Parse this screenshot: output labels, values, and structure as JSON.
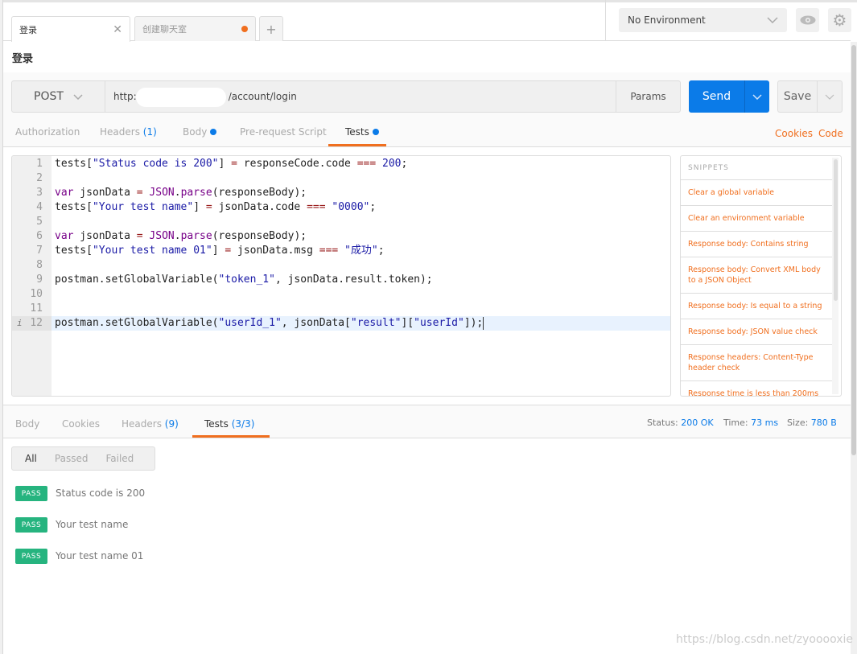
{
  "tabs": [
    {
      "label": "登录",
      "active": true
    },
    {
      "label": "创建聊天室",
      "unsaved": true
    }
  ],
  "add_tab_label": "+",
  "environment": {
    "selected": "No Environment"
  },
  "request": {
    "title": "登录",
    "method": "POST",
    "url_prefix": "http:",
    "url_suffix": "/account/login",
    "params_label": "Params",
    "send_label": "Send",
    "save_label": "Save"
  },
  "request_tabs": [
    {
      "label": "Authorization"
    },
    {
      "label": "Headers",
      "count": "(1)"
    },
    {
      "label": "Body",
      "dot": true
    },
    {
      "label": "Pre-request Script"
    },
    {
      "label": "Tests",
      "dot": true,
      "active": true
    }
  ],
  "links": {
    "cookies": "Cookies",
    "code": "Code"
  },
  "code_lines": [
    {
      "n": "1",
      "t": [
        [
          "pl",
          "tests["
        ],
        [
          "str",
          "\"Status code is 200\""
        ],
        [
          "pl",
          "] "
        ],
        [
          "op",
          "="
        ],
        [
          "pl",
          " responseCode.code "
        ],
        [
          "op",
          "==="
        ],
        [
          "pl",
          " "
        ],
        [
          "num",
          "200"
        ],
        [
          "pl",
          ";"
        ]
      ]
    },
    {
      "n": "2",
      "t": []
    },
    {
      "n": "3",
      "t": [
        [
          "kw",
          "var"
        ],
        [
          "pl",
          " jsonData "
        ],
        [
          "op",
          "="
        ],
        [
          "pl",
          " "
        ],
        [
          "kw",
          "JSON"
        ],
        [
          "pl",
          "."
        ],
        [
          "kw",
          "parse"
        ],
        [
          "pl",
          "(responseBody);"
        ]
      ]
    },
    {
      "n": "4",
      "t": [
        [
          "pl",
          "tests["
        ],
        [
          "str",
          "\"Your test name\""
        ],
        [
          "pl",
          "] "
        ],
        [
          "op",
          "="
        ],
        [
          "pl",
          " jsonData.code "
        ],
        [
          "op",
          "==="
        ],
        [
          "pl",
          " "
        ],
        [
          "str",
          "\"0000\""
        ],
        [
          "pl",
          ";"
        ]
      ]
    },
    {
      "n": "5",
      "t": []
    },
    {
      "n": "6",
      "t": [
        [
          "kw",
          "var"
        ],
        [
          "pl",
          " jsonData "
        ],
        [
          "op",
          "="
        ],
        [
          "pl",
          " "
        ],
        [
          "kw",
          "JSON"
        ],
        [
          "pl",
          "."
        ],
        [
          "kw",
          "parse"
        ],
        [
          "pl",
          "(responseBody);"
        ]
      ]
    },
    {
      "n": "7",
      "t": [
        [
          "pl",
          "tests["
        ],
        [
          "str",
          "\"Your test name 01\""
        ],
        [
          "pl",
          "] "
        ],
        [
          "op",
          "="
        ],
        [
          "pl",
          " jsonData.msg "
        ],
        [
          "op",
          "==="
        ],
        [
          "pl",
          " "
        ],
        [
          "str",
          "\"成功\""
        ],
        [
          "pl",
          ";"
        ]
      ]
    },
    {
      "n": "8",
      "t": []
    },
    {
      "n": "9",
      "t": [
        [
          "pl",
          "postman.setGlobalVariable("
        ],
        [
          "str",
          "\"token_1\""
        ],
        [
          "pl",
          ", jsonData.result.token);"
        ]
      ]
    },
    {
      "n": "10",
      "t": []
    },
    {
      "n": "11",
      "t": []
    },
    {
      "n": "12",
      "cur": true,
      "info": "i",
      "t": [
        [
          "pl",
          "postman.setGlobalVariable("
        ],
        [
          "str",
          "\"userId_1\""
        ],
        [
          "pl",
          ", jsonData["
        ],
        [
          "str",
          "\"result\""
        ],
        [
          "pl",
          "]["
        ],
        [
          "str",
          "\"userId\""
        ],
        [
          "pl",
          "]);"
        ]
      ]
    }
  ],
  "snippets": {
    "header": "SNIPPETS",
    "items": [
      "Clear a global variable",
      "Clear an environment variable",
      "Response body: Contains string",
      "Response body: Convert XML body to a JSON Object",
      "Response body: Is equal to a string",
      "Response body: JSON value check",
      "Response headers: Content-Type header check",
      "Response time is less than 200ms"
    ]
  },
  "response_tabs": [
    {
      "label": "Body"
    },
    {
      "label": "Cookies"
    },
    {
      "label": "Headers",
      "count": "(9)"
    },
    {
      "label": "Tests",
      "count": "(3/3)",
      "active": true
    }
  ],
  "response_meta": {
    "status_label": "Status:",
    "status": "200 OK",
    "time_label": "Time:",
    "time": "73 ms",
    "size_label": "Size:",
    "size": "780 B"
  },
  "filters": [
    "All",
    "Passed",
    "Failed"
  ],
  "results": [
    {
      "badge": "PASS",
      "name": "Status code is 200"
    },
    {
      "badge": "PASS",
      "name": "Your test name"
    },
    {
      "badge": "PASS",
      "name": "Your test name 01"
    }
  ],
  "watermark": "https://blog.csdn.net/zyooooxie",
  "colors": {
    "accent": "#f06f1f",
    "send": "#0b7be8",
    "pass": "#26b47f",
    "link_blue": "#0b7be8"
  }
}
